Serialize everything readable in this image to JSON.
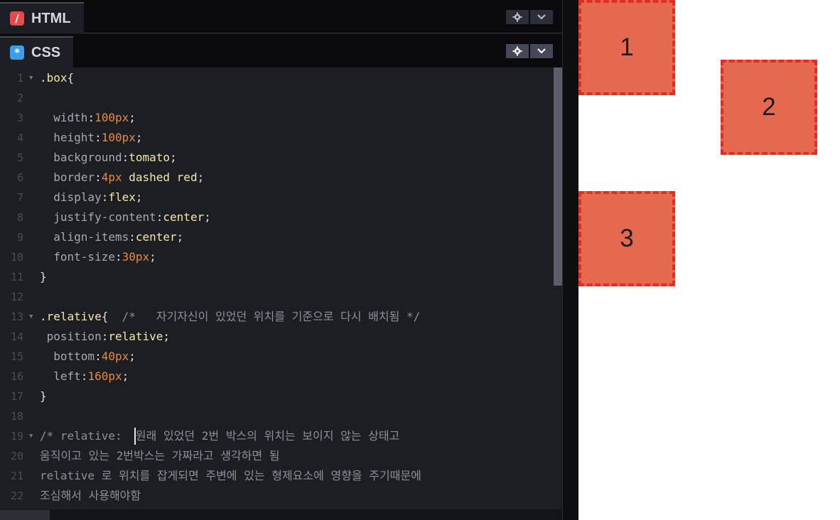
{
  "html_panel": {
    "title": "HTML",
    "icon": "html-slash-icon"
  },
  "css_panel": {
    "title": "CSS",
    "icon": "css-asterisk-icon"
  },
  "code": [
    {
      "n": "1",
      "fold": true,
      "parts": [
        {
          "t": ".box",
          "c": "sel"
        },
        {
          "t": "{",
          "c": "punc"
        }
      ]
    },
    {
      "n": "2",
      "fold": false,
      "parts": []
    },
    {
      "n": "3",
      "fold": false,
      "parts": [
        {
          "t": "  width",
          "c": "prop"
        },
        {
          "t": ":",
          "c": "punc"
        },
        {
          "t": "100px",
          "c": "num"
        },
        {
          "t": ";",
          "c": "punc"
        }
      ]
    },
    {
      "n": "4",
      "fold": false,
      "parts": [
        {
          "t": "  height",
          "c": "prop"
        },
        {
          "t": ":",
          "c": "punc"
        },
        {
          "t": "100px",
          "c": "num"
        },
        {
          "t": ";",
          "c": "punc"
        }
      ]
    },
    {
      "n": "5",
      "fold": false,
      "parts": [
        {
          "t": "  background",
          "c": "prop"
        },
        {
          "t": ":",
          "c": "punc"
        },
        {
          "t": "tomato",
          "c": "val"
        },
        {
          "t": ";",
          "c": "punc"
        }
      ]
    },
    {
      "n": "6",
      "fold": false,
      "parts": [
        {
          "t": "  border",
          "c": "prop"
        },
        {
          "t": ":",
          "c": "punc"
        },
        {
          "t": "4px",
          "c": "num"
        },
        {
          "t": " dashed red",
          "c": "val"
        },
        {
          "t": ";",
          "c": "punc"
        }
      ]
    },
    {
      "n": "7",
      "fold": false,
      "parts": [
        {
          "t": "  display",
          "c": "prop"
        },
        {
          "t": ":",
          "c": "punc"
        },
        {
          "t": "flex",
          "c": "val"
        },
        {
          "t": ";",
          "c": "punc"
        }
      ]
    },
    {
      "n": "8",
      "fold": false,
      "parts": [
        {
          "t": "  justify-content",
          "c": "prop"
        },
        {
          "t": ":",
          "c": "punc"
        },
        {
          "t": "center",
          "c": "val"
        },
        {
          "t": ";",
          "c": "punc"
        }
      ]
    },
    {
      "n": "9",
      "fold": false,
      "parts": [
        {
          "t": "  align-items",
          "c": "prop"
        },
        {
          "t": ":",
          "c": "punc"
        },
        {
          "t": "center",
          "c": "val"
        },
        {
          "t": ";",
          "c": "punc"
        }
      ]
    },
    {
      "n": "10",
      "fold": false,
      "parts": [
        {
          "t": "  font-size",
          "c": "prop"
        },
        {
          "t": ":",
          "c": "punc"
        },
        {
          "t": "30px",
          "c": "num"
        },
        {
          "t": ";",
          "c": "punc"
        }
      ]
    },
    {
      "n": "11",
      "fold": false,
      "parts": [
        {
          "t": "}",
          "c": "punc"
        }
      ]
    },
    {
      "n": "12",
      "fold": false,
      "parts": []
    },
    {
      "n": "13",
      "fold": true,
      "parts": [
        {
          "t": ".relative",
          "c": "sel"
        },
        {
          "t": "{  ",
          "c": "punc"
        },
        {
          "t": "/*   자기자신이 있었던 위치를 기준으로 다시 배치됨 */",
          "c": "com"
        }
      ]
    },
    {
      "n": "14",
      "fold": false,
      "parts": [
        {
          "t": " position",
          "c": "prop"
        },
        {
          "t": ":",
          "c": "punc"
        },
        {
          "t": "relative",
          "c": "val"
        },
        {
          "t": ";",
          "c": "punc"
        }
      ]
    },
    {
      "n": "15",
      "fold": false,
      "parts": [
        {
          "t": "  bottom",
          "c": "prop"
        },
        {
          "t": ":",
          "c": "punc"
        },
        {
          "t": "40px",
          "c": "num"
        },
        {
          "t": ";",
          "c": "punc"
        }
      ]
    },
    {
      "n": "16",
      "fold": false,
      "parts": [
        {
          "t": "  left",
          "c": "prop"
        },
        {
          "t": ":",
          "c": "punc"
        },
        {
          "t": "160px",
          "c": "num"
        },
        {
          "t": ";",
          "c": "punc"
        }
      ]
    },
    {
      "n": "17",
      "fold": false,
      "parts": [
        {
          "t": "}",
          "c": "punc"
        }
      ]
    },
    {
      "n": "18",
      "fold": false,
      "parts": []
    },
    {
      "n": "19",
      "fold": true,
      "parts": [
        {
          "t": "/* relative:  원래 있었던 2번 박스의 위치는 보이지 않는 상태고",
          "c": "com"
        }
      ]
    },
    {
      "n": "20",
      "fold": false,
      "parts": [
        {
          "t": "움직이고 있는 2번박스는 가짜라고 생각하면 됨",
          "c": "com"
        }
      ]
    },
    {
      "n": "21",
      "fold": false,
      "parts": [
        {
          "t": "relative 로 위치를 잡게되면 주변에 있는 형제요소에 영향을 주기때문에",
          "c": "com"
        }
      ]
    },
    {
      "n": "22",
      "fold": false,
      "parts": [
        {
          "t": "조심해서 사용해야함",
          "c": "com"
        }
      ]
    }
  ],
  "preview": {
    "boxes": [
      {
        "label": "1"
      },
      {
        "label": "2"
      },
      {
        "label": "3"
      }
    ],
    "colors": {
      "box_fill": "#e5694f",
      "box_border": "#e02f22"
    }
  }
}
